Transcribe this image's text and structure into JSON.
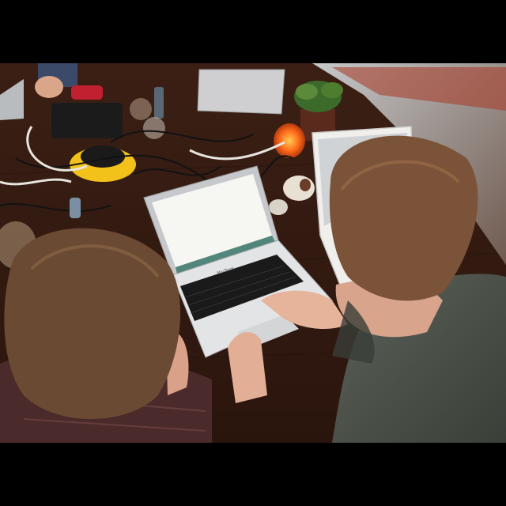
{
  "scene": {
    "description": "",
    "colors": {
      "table": "#4a2618",
      "table_dark": "#2c140c",
      "window": "#8a8f93",
      "candle": "#ff6a1a",
      "laptop_silver": "#d9dadc",
      "screen": "#f5f5f0",
      "hair_left": "#6a4a32",
      "hair_right": "#7a5238",
      "shirt_right": "#4a5048",
      "shirt_left": "#4a2a2a"
    },
    "brand_label": "MacBook"
  }
}
